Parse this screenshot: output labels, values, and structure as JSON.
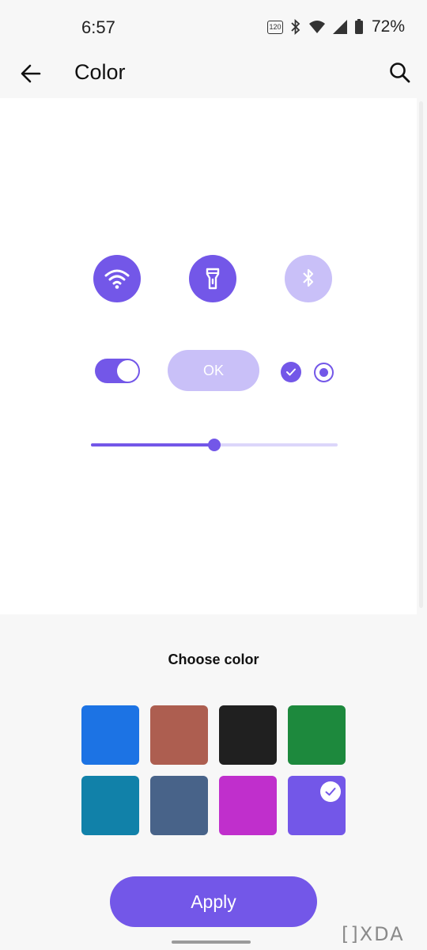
{
  "status_bar": {
    "time": "6:57",
    "refresh_rate_badge": "120",
    "battery_percent": "72%"
  },
  "app_bar": {
    "title": "Color",
    "back_icon": "arrow-left-icon",
    "search_icon": "search-icon"
  },
  "preview": {
    "quick_tiles": [
      {
        "icon": "wifi-icon",
        "active": true
      },
      {
        "icon": "flashlight-icon",
        "active": true
      },
      {
        "icon": "bluetooth-icon",
        "active": false
      }
    ],
    "toggle_on": true,
    "ok_label": "OK",
    "checkbox_checked": true,
    "radio_selected": true,
    "slider_value": 0.5
  },
  "color_picker": {
    "title": "Choose color",
    "swatches": [
      {
        "color": "#1c73e4",
        "selected": false
      },
      {
        "color": "#ad5e50",
        "selected": false
      },
      {
        "color": "#202020",
        "selected": false
      },
      {
        "color": "#1d893d",
        "selected": false
      },
      {
        "color": "#1181a9",
        "selected": false
      },
      {
        "color": "#486389",
        "selected": false
      },
      {
        "color": "#c02fcc",
        "selected": false
      },
      {
        "color": "#7357e8",
        "selected": true
      }
    ]
  },
  "apply_label": "Apply",
  "watermark": "XDA",
  "accent_color": "#7357e8",
  "accent_light_color": "#c9c0f8"
}
